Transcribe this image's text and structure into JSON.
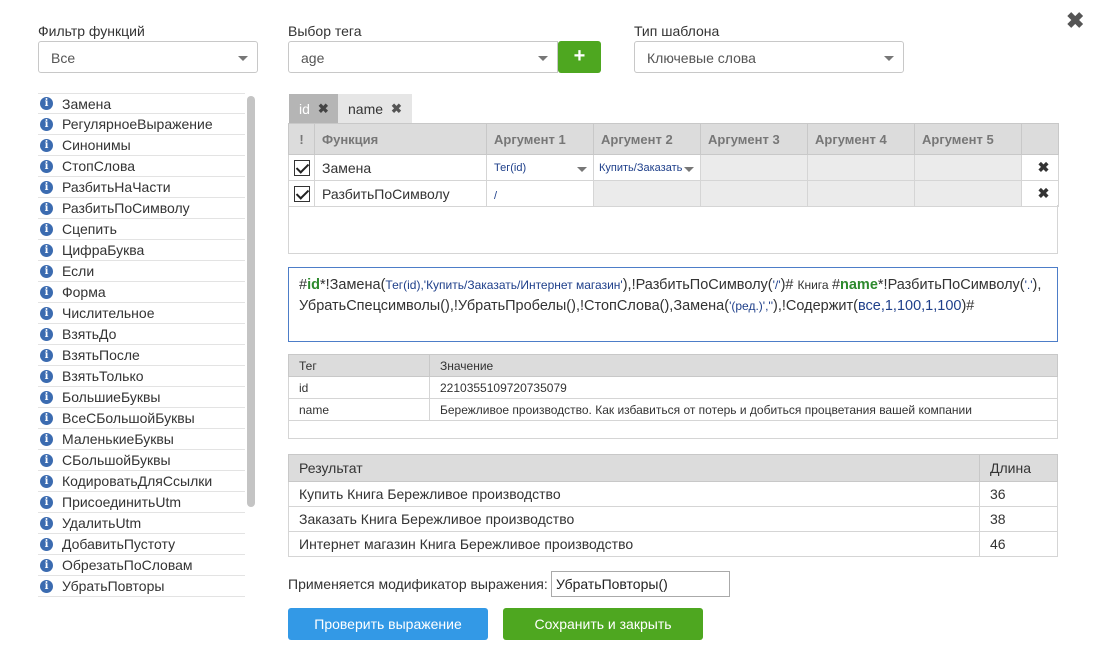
{
  "filters": {
    "function_filter_label": "Фильтр функций",
    "function_filter_value": "Все",
    "tag_select_label": "Выбор тега",
    "tag_select_value": "age",
    "add_button_label": "+",
    "template_type_label": "Тип шаблона",
    "template_type_value": "Ключевые слова"
  },
  "close_label": "✖",
  "function_list": [
    "Замена",
    "РегулярноеВыражение",
    "Синонимы",
    "СтопСлова",
    "РазбитьНаЧасти",
    "РазбитьПоСимволу",
    "Сцепить",
    "ЦифраБуква",
    "Если",
    "Форма",
    "Числительное",
    "ВзятьДо",
    "ВзятьПосле",
    "ВзятьТолько",
    "БольшиеБуквы",
    "ВсеСБольшойБуквы",
    "МаленькиеБуквы",
    "СБольшойБуквы",
    "КодироватьДляСсылки",
    "ПрисоединитьUtm",
    "УдалитьUtm",
    "ДобавитьПустоту",
    "ОбрезатьПоСловам",
    "УбратьПовторы"
  ],
  "info_icon": "i",
  "tabs": [
    {
      "label": "id",
      "close": "✖"
    },
    {
      "label": "name",
      "close": "✖"
    }
  ],
  "func_table": {
    "headers": [
      "!",
      "Функция",
      "Аргумент 1",
      "Аргумент 2",
      "Аргумент 3",
      "Аргумент 4",
      "Аргумент 5",
      ""
    ],
    "rows": [
      {
        "name": "Замена",
        "arg1": "Тег(id)",
        "arg2": "Купить/Заказать",
        "delete": "✖"
      },
      {
        "name": "РазбитьПоСимволу",
        "arg1": "/",
        "arg2": "",
        "delete": "✖"
      }
    ]
  },
  "expression": {
    "p1": "#",
    "t1": "id",
    "p2": "*!Замена(",
    "a1": "Тег(id),'Купить/Заказать/Интернет магазин'",
    "p3": "),!РазбитьПоСимволу(",
    "a2": "'/'",
    "p4": ")# ",
    "s1": "Книга ",
    "p5": "#",
    "t2": "name",
    "p6": "*!РазбитьПоСимволу(",
    "a3": "'.'",
    "p7": "),УбратьСпецсимволы(),!УбратьПробелы(),!СтопСлова(),Замена(",
    "a4": "'(ред.)',''",
    "p8": "),!Содержит(",
    "a5": "все,1,100,1,100",
    "p9": ")#"
  },
  "tag_values": {
    "headers": [
      "Тег",
      "Значение"
    ],
    "rows": [
      {
        "tag": "id",
        "value": "2210355109720735079"
      },
      {
        "tag": "name",
        "value": "Бережливое производство. Как избавиться от потерь и добиться процветания вашей компании"
      }
    ]
  },
  "results": {
    "headers": [
      "Результат",
      "Длина"
    ],
    "rows": [
      {
        "text": "Купить Книга Бережливое производство",
        "length": "36"
      },
      {
        "text": "Заказать Книга Бережливое производство",
        "length": "38"
      },
      {
        "text": "Интернет магазин Книга Бережливое производство",
        "length": "46"
      }
    ]
  },
  "modifier": {
    "label": "Применяется модификатор выражения:",
    "value": "УбратьПовторы()"
  },
  "buttons": {
    "check": "Проверить выражение",
    "save": "Сохранить и закрыть"
  },
  "colors": {
    "accent_blue": "#3399e6",
    "accent_green": "#4ea720",
    "tag_green": "#2d8a2d",
    "arg_blue": "#1e3f8a"
  }
}
